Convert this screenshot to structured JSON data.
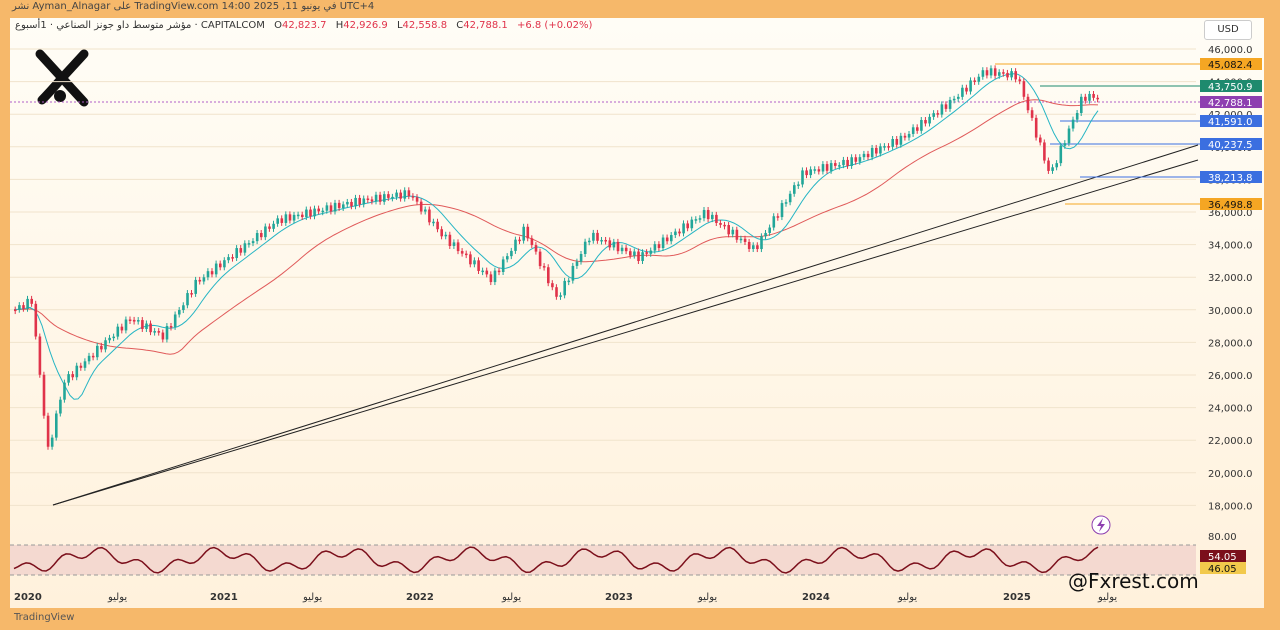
{
  "header": {
    "publisher": "نشر Ayman_Alnagar على TradingView.com في يونيو 11, 2025 14:00 UTC+4",
    "symbol_title": "مؤشر متوسط داو جونز الصناعي · 1أسبوع · CAPITALCOM",
    "ohlc": [
      {
        "k": "O",
        "v": "42,823.7"
      },
      {
        "k": "H",
        "v": "42,926.9"
      },
      {
        "k": "L",
        "v": "42,558.8"
      },
      {
        "k": "C",
        "v": "42,788.1"
      }
    ],
    "change": "+6.8 (+0.02%)"
  },
  "currency": "USD",
  "brand": "@Fxrest.com",
  "tv_logo": "TradingView",
  "colors": {
    "up": "#22a699",
    "down": "#e0334a",
    "ma_fast": "#26b5c4",
    "ma_slow": "#e05a5a",
    "rsi": "#7b0f1b"
  },
  "chart_data": {
    "type": "candlestick",
    "title": "",
    "timeframe": "1W",
    "ylim": [
      17000,
      47000
    ],
    "y_ticks": [
      "46,000.0",
      "44,000.0",
      "42,000.0",
      "40,000.0",
      "38,000.0",
      "36,000.0",
      "34,000.0",
      "32,000.0",
      "30,000.0",
      "28,000.0",
      "26,000.0",
      "24,000.0",
      "22,000.0",
      "20,000.0",
      "18,000.0"
    ],
    "x_ticks": [
      "2020",
      "يوليو",
      "2021",
      "يوليو",
      "2022",
      "يوليو",
      "2023",
      "يوليو",
      "2024",
      "يوليو",
      "2025",
      "يوليو"
    ],
    "price_series": [
      {
        "x": "2020-01",
        "y": 28500
      },
      {
        "x": "2020-02",
        "y": 29100
      },
      {
        "x": "2020-03",
        "y": 19000
      },
      {
        "x": "2020-04",
        "y": 23700
      },
      {
        "x": "2020-06",
        "y": 25800
      },
      {
        "x": "2020-08",
        "y": 27900
      },
      {
        "x": "2020-10",
        "y": 26700
      },
      {
        "x": "2020-12",
        "y": 30300
      },
      {
        "x": "2021-03",
        "y": 32800
      },
      {
        "x": "2021-05",
        "y": 34500
      },
      {
        "x": "2021-08",
        "y": 35300
      },
      {
        "x": "2021-10",
        "y": 35800
      },
      {
        "x": "2022-01",
        "y": 36300
      },
      {
        "x": "2022-03",
        "y": 33500
      },
      {
        "x": "2022-06",
        "y": 30500
      },
      {
        "x": "2022-08",
        "y": 33900
      },
      {
        "x": "2022-10",
        "y": 29200
      },
      {
        "x": "2022-12",
        "y": 33500
      },
      {
        "x": "2023-03",
        "y": 32000
      },
      {
        "x": "2023-07",
        "y": 35000
      },
      {
        "x": "2023-10",
        "y": 32500
      },
      {
        "x": "2024-01",
        "y": 37700
      },
      {
        "x": "2024-04",
        "y": 38500
      },
      {
        "x": "2024-07",
        "y": 40000
      },
      {
        "x": "2024-10",
        "y": 42500
      },
      {
        "x": "2024-12",
        "y": 44500
      },
      {
        "x": "2025-02",
        "y": 44200
      },
      {
        "x": "2025-04",
        "y": 37500
      },
      {
        "x": "2025-06",
        "y": 42788.1
      }
    ],
    "price_tags": [
      {
        "value": "45,082.4",
        "bg": "#f5a623",
        "fg": "#111"
      },
      {
        "value": "43,750.9",
        "bg": "#1e8a6e",
        "fg": "#fff"
      },
      {
        "value": "42,788.1",
        "bg": "#8e3fb0",
        "fg": "#fff"
      },
      {
        "value": "41,591.0",
        "bg": "#3b6fe0",
        "fg": "#fff"
      },
      {
        "value": "40,237.5",
        "bg": "#3b6fe0",
        "fg": "#fff"
      },
      {
        "value": "38,213.8",
        "bg": "#3b6fe0",
        "fg": "#fff"
      },
      {
        "value": "36,498.8",
        "bg": "#f5a623",
        "fg": "#111"
      }
    ],
    "rsi": {
      "levels": [
        "80.00"
      ],
      "value_tags": [
        {
          "value": "54.05",
          "bg": "#7b0f1b",
          "fg": "#fff"
        },
        {
          "value": "46.05",
          "bg": "#f2c94c",
          "fg": "#111"
        }
      ]
    }
  }
}
